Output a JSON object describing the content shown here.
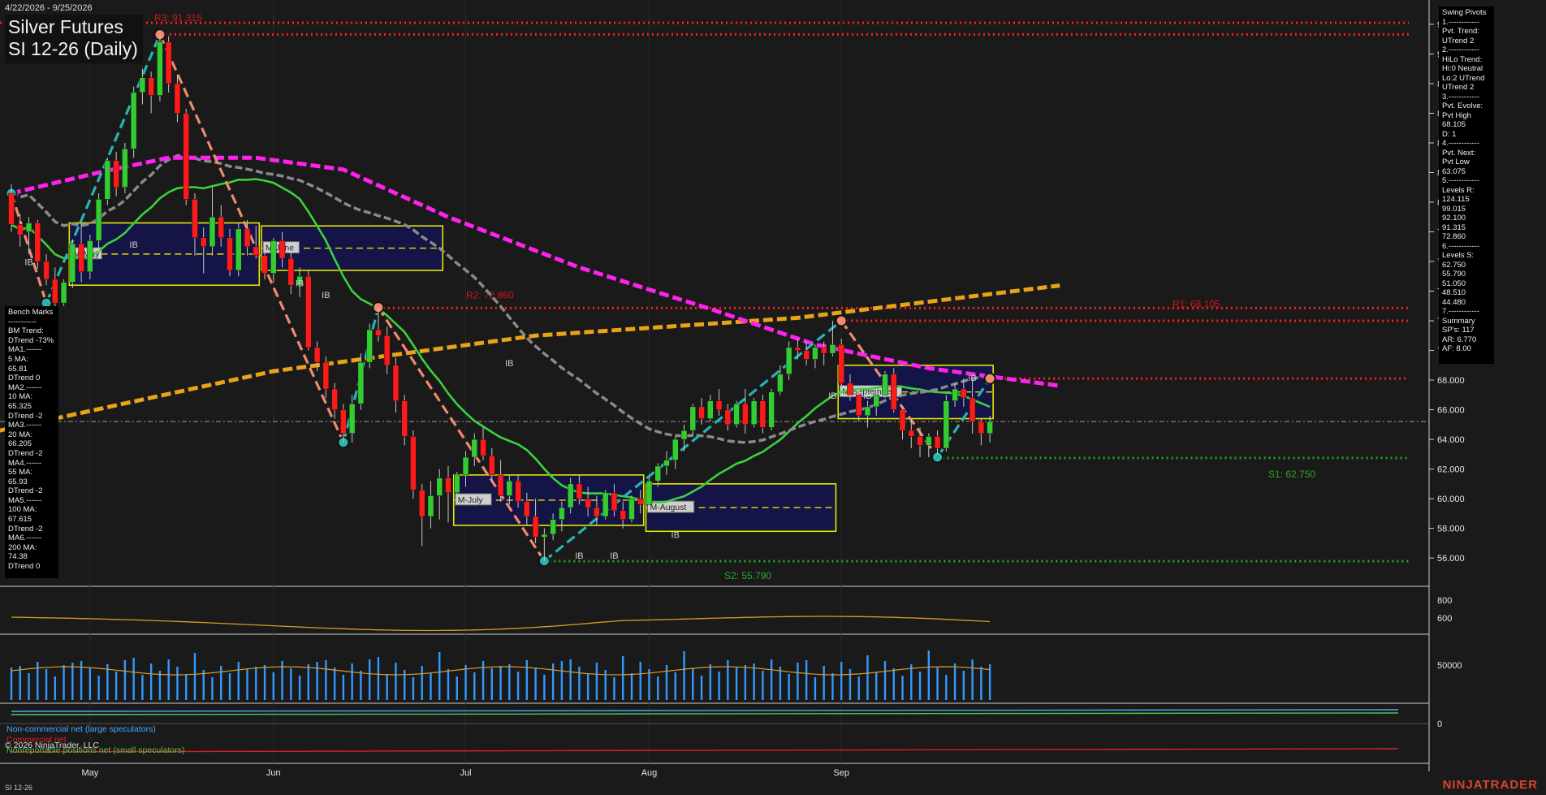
{
  "header": {
    "date_range": "4/22/2026 - 9/25/2026",
    "title_line1": "Silver Futures",
    "title_line2": "SI 12-26 (Daily)"
  },
  "price_axis": {
    "labels": [
      "92.000",
      "90.000",
      "88.000",
      "86.000",
      "84.000",
      "82.000",
      "80.000",
      "78.000",
      "76.000",
      "74.000",
      "72.000",
      "70.000",
      "68.000",
      "66.000",
      "64.000",
      "62.000",
      "60.000",
      "58.000",
      "56.000"
    ],
    "values": [
      92,
      90,
      88,
      86,
      84,
      82,
      80,
      78,
      76,
      74,
      72,
      70,
      68,
      66,
      64,
      62,
      60,
      58,
      56
    ],
    "range": [
      54.2,
      93.2
    ]
  },
  "oi_axis": {
    "labels": [
      "800",
      "600"
    ]
  },
  "volume_axis": {
    "labels": [
      "50000"
    ]
  },
  "cot_axis": {
    "labels": [
      "0"
    ]
  },
  "time_axis": {
    "labels": [
      "May",
      "Jun",
      "Jul",
      "Aug",
      "Sep"
    ],
    "bar_index": [
      9,
      30,
      52,
      73,
      95
    ]
  },
  "level_labels": {
    "r3": "R3: 91.315",
    "r2": "R2: 72.860",
    "r1": "R1: 68.105",
    "s1": "S1: 62.750",
    "s2": "S2: 55.790"
  },
  "month_labels": {
    "may": "M-May",
    "june": "M-June",
    "july": "M-July",
    "august": "M-August",
    "september": "M-September"
  },
  "ib_label": "IB",
  "benchmarks": [
    "Bench Marks",
    "-----------",
    "BM Trend:",
    "DTrend -73%",
    "MA1.------",
    "5 MA:",
    "65.81",
    "DTrend 0",
    "MA2.------",
    "10 MA:",
    "65.325",
    "DTrend -2",
    "MA3.------",
    "20 MA:",
    "66.205",
    "DTrend -2",
    "MA4.------",
    "55 MA:",
    "65.93",
    "DTrend -2",
    "MA5.------",
    "100 MA:",
    "67.615",
    "DTrend -2",
    "MA6.------",
    "200 MA:",
    "74.38",
    "DTrend 0"
  ],
  "swing_pivots": [
    "Swing Pivots",
    "1.------------",
    "Pvt. Trend:",
    "UTrend 2",
    "2.------------",
    "HiLo Trend:",
    "Hi:0 Neutral",
    "Lo:2 UTrend",
    "UTrend 2",
    "3.------------",
    "Pvt. Evolve:",
    "Pvt High",
    "68.105",
    "D: 1",
    "4.------------",
    "Pvt. Next:",
    "Pvt Low",
    "63.075",
    "5.------------",
    "Levels R:",
    "124.115",
    "99.015",
    "92.100",
    "91.315",
    "72.860",
    "6.------------",
    "Levels S:",
    "62.750",
    "55.790",
    "51.050",
    "48.510",
    "44.480",
    "7.------------",
    "Summary",
    "SP's: 117",
    "AR: 6.770",
    "AF: 8.00"
  ],
  "legend": {
    "noncommercial": "Non-commercial net (large speculators)",
    "commercial": "Commercial net",
    "nonreportable": "Nonreportable positions net (small speculators)"
  },
  "copyright": "© 2026 NinjaTrader, LLC",
  "footer_symbol": "SI 12-26",
  "brand": "NINJATRADER",
  "colors": {
    "background": "#1a1a1a",
    "up_candle": "#33cc33",
    "down_candle": "#ff1a1a",
    "ma_magenta": "#ff22ee",
    "ma_orange": "#e8a317",
    "ma_gray": "#8a8a8a",
    "ma_green": "#3bd13b",
    "swing_up": "#2ab3b3",
    "swing_down": "#f08a70",
    "resistance": "#ff2020",
    "support": "#22aa22",
    "month_box_fill": "#141446",
    "month_box_border": "#e5e500",
    "volume": "#3399ff"
  },
  "chart_data": {
    "type": "candlestick",
    "x_unit": "trading day index (0 = 4/22/2026)",
    "ohlc": [
      [
        80.6,
        81.2,
        78.0,
        78.5
      ],
      [
        78.5,
        79.2,
        77.0,
        77.8
      ],
      [
        78.0,
        79.0,
        76.5,
        78.6
      ],
      [
        78.6,
        78.8,
        75.5,
        76.0
      ],
      [
        76.0,
        76.5,
        74.4,
        74.8
      ],
      [
        74.8,
        75.6,
        72.6,
        73.2
      ],
      [
        73.2,
        74.8,
        73.0,
        74.6
      ],
      [
        74.6,
        77.5,
        74.2,
        77.2
      ],
      [
        77.2,
        78.6,
        74.6,
        75.3
      ],
      [
        75.3,
        77.8,
        74.8,
        77.4
      ],
      [
        77.4,
        80.6,
        76.6,
        80.2
      ],
      [
        80.2,
        83.0,
        79.8,
        82.8
      ],
      [
        82.8,
        83.4,
        80.4,
        81.0
      ],
      [
        81.0,
        84.0,
        80.6,
        83.6
      ],
      [
        83.6,
        87.8,
        83.0,
        87.4
      ],
      [
        87.4,
        89.0,
        86.6,
        88.4
      ],
      [
        88.4,
        88.8,
        86.0,
        87.2
      ],
      [
        87.2,
        91.3,
        86.8,
        90.8
      ],
      [
        90.8,
        91.2,
        87.4,
        88.0
      ],
      [
        88.0,
        88.6,
        85.4,
        86.0
      ],
      [
        86.0,
        86.3,
        79.8,
        80.2
      ],
      [
        80.2,
        80.6,
        76.4,
        77.6
      ],
      [
        77.6,
        78.3,
        75.2,
        77.0
      ],
      [
        77.0,
        81.0,
        76.4,
        79.0
      ],
      [
        79.0,
        79.8,
        77.0,
        77.6
      ],
      [
        77.6,
        78.2,
        75.0,
        75.4
      ],
      [
        75.4,
        78.6,
        75.0,
        78.2
      ],
      [
        78.2,
        78.8,
        76.4,
        77.0
      ],
      [
        77.0,
        78.4,
        76.2,
        76.4
      ],
      [
        76.4,
        76.9,
        74.8,
        75.2
      ],
      [
        75.2,
        77.6,
        74.6,
        77.4
      ],
      [
        77.4,
        78.0,
        75.6,
        76.2
      ],
      [
        76.2,
        76.6,
        73.8,
        74.4
      ],
      [
        74.4,
        75.6,
        73.6,
        75.0
      ],
      [
        75.0,
        75.4,
        70.0,
        70.2
      ],
      [
        70.2,
        70.6,
        68.6,
        69.2
      ],
      [
        69.2,
        69.6,
        66.8,
        67.4
      ],
      [
        67.4,
        67.8,
        65.4,
        66.0
      ],
      [
        66.0,
        66.4,
        63.8,
        64.4
      ],
      [
        64.4,
        67.0,
        63.8,
        66.4
      ],
      [
        66.4,
        69.8,
        66.0,
        69.2
      ],
      [
        69.2,
        71.8,
        68.8,
        71.4
      ],
      [
        71.4,
        72.9,
        70.6,
        71.0
      ],
      [
        71.0,
        71.6,
        68.4,
        69.0
      ],
      [
        69.0,
        69.5,
        65.8,
        66.6
      ],
      [
        66.6,
        67.0,
        63.6,
        64.2
      ],
      [
        64.2,
        64.6,
        60.0,
        60.6
      ],
      [
        60.6,
        61.0,
        56.8,
        58.8
      ],
      [
        58.8,
        61.2,
        58.0,
        60.2
      ],
      [
        60.2,
        62.0,
        58.6,
        61.4
      ],
      [
        61.4,
        62.2,
        58.4,
        60.4
      ],
      [
        60.4,
        61.8,
        59.6,
        61.6
      ],
      [
        61.6,
        63.2,
        60.8,
        62.8
      ],
      [
        62.8,
        64.4,
        62.2,
        64.0
      ],
      [
        64.0,
        64.8,
        62.6,
        62.9
      ],
      [
        62.9,
        63.4,
        61.2,
        61.6
      ],
      [
        61.6,
        62.6,
        59.8,
        60.2
      ],
      [
        60.2,
        61.6,
        59.6,
        61.2
      ],
      [
        61.2,
        61.6,
        59.4,
        59.8
      ],
      [
        59.8,
        60.4,
        58.2,
        58.8
      ],
      [
        58.8,
        60.0,
        57.0,
        57.4
      ],
      [
        57.4,
        58.0,
        55.8,
        57.6
      ],
      [
        57.6,
        59.0,
        57.2,
        58.6
      ],
      [
        58.6,
        59.8,
        57.8,
        59.4
      ],
      [
        59.4,
        61.4,
        59.0,
        61.0
      ],
      [
        61.0,
        61.6,
        59.6,
        60.0
      ],
      [
        60.0,
        60.8,
        58.8,
        59.4
      ],
      [
        59.4,
        60.2,
        58.2,
        58.8
      ],
      [
        58.8,
        60.6,
        58.6,
        60.4
      ],
      [
        60.4,
        61.0,
        58.8,
        59.2
      ],
      [
        59.2,
        59.8,
        58.0,
        58.6
      ],
      [
        58.6,
        60.2,
        58.4,
        60.0
      ],
      [
        60.0,
        60.6,
        59.0,
        59.6
      ],
      [
        59.6,
        61.4,
        59.2,
        61.2
      ],
      [
        61.2,
        62.4,
        60.8,
        62.2
      ],
      [
        62.2,
        63.2,
        61.6,
        62.6
      ],
      [
        62.6,
        64.2,
        62.0,
        64.0
      ],
      [
        64.0,
        65.0,
        63.2,
        64.6
      ],
      [
        64.6,
        66.4,
        64.2,
        66.2
      ],
      [
        66.2,
        66.8,
        65.0,
        65.4
      ],
      [
        65.4,
        67.0,
        65.2,
        66.6
      ],
      [
        66.6,
        67.4,
        65.6,
        66.0
      ],
      [
        66.0,
        66.4,
        64.6,
        65.0
      ],
      [
        65.0,
        66.6,
        64.8,
        66.4
      ],
      [
        66.4,
        67.4,
        64.4,
        65.0
      ],
      [
        65.0,
        66.8,
        64.8,
        66.6
      ],
      [
        66.6,
        67.0,
        64.4,
        64.8
      ],
      [
        64.8,
        67.4,
        64.6,
        67.2
      ],
      [
        67.2,
        69.0,
        67.0,
        68.4
      ],
      [
        68.4,
        70.6,
        68.0,
        70.2
      ],
      [
        70.2,
        70.8,
        69.4,
        70.0
      ],
      [
        70.0,
        70.6,
        69.0,
        69.4
      ],
      [
        69.4,
        70.4,
        68.8,
        70.2
      ],
      [
        70.2,
        70.6,
        69.0,
        69.8
      ],
      [
        69.8,
        72.0,
        69.6,
        70.4
      ],
      [
        70.4,
        70.8,
        67.6,
        67.8
      ],
      [
        67.8,
        68.4,
        66.6,
        67.0
      ],
      [
        67.0,
        67.6,
        65.2,
        65.6
      ],
      [
        65.6,
        66.6,
        64.8,
        66.2
      ],
      [
        66.2,
        67.4,
        65.6,
        67.0
      ],
      [
        67.0,
        68.6,
        66.8,
        68.4
      ],
      [
        68.4,
        68.8,
        65.8,
        66.0
      ],
      [
        66.0,
        66.2,
        64.0,
        64.6
      ],
      [
        64.6,
        65.4,
        63.4,
        64.2
      ],
      [
        64.2,
        64.8,
        62.8,
        63.6
      ],
      [
        63.6,
        64.4,
        62.8,
        64.2
      ],
      [
        64.2,
        64.6,
        63.0,
        63.4
      ],
      [
        63.4,
        67.0,
        63.2,
        66.6
      ],
      [
        66.6,
        67.8,
        66.2,
        67.4
      ],
      [
        67.4,
        68.1,
        66.2,
        66.8
      ],
      [
        66.8,
        68.0,
        64.4,
        65.2
      ],
      [
        65.2,
        65.4,
        63.6,
        64.4
      ],
      [
        64.4,
        65.6,
        63.8,
        65.2
      ]
    ],
    "moving_averages": [
      {
        "name": "5 MA",
        "value": 65.81
      },
      {
        "name": "10 MA",
        "value": 65.325
      },
      {
        "name": "20 MA",
        "value": 66.205
      },
      {
        "name": "55 MA",
        "value": 65.93
      },
      {
        "name": "100 MA",
        "value": 67.615
      },
      {
        "name": "200 MA",
        "value": 74.38
      }
    ],
    "resistance_levels": [
      92.1,
      91.315,
      72.86,
      68.105
    ],
    "support_levels": [
      62.75,
      55.79
    ],
    "swing_pivots": [
      [
        0,
        80.6
      ],
      [
        4,
        73.2
      ],
      [
        17,
        91.3
      ],
      [
        38,
        63.8
      ],
      [
        42,
        72.9
      ],
      [
        61,
        55.8
      ],
      [
        95,
        72.0
      ],
      [
        106,
        62.8
      ],
      [
        112,
        68.1
      ]
    ],
    "month_boxes": [
      {
        "label": "M-May",
        "from": 7,
        "to": 28,
        "high": 78.6,
        "low": 74.4
      },
      {
        "label": "M-June",
        "from": 29,
        "to": 49,
        "high": 78.4,
        "low": 75.4
      },
      {
        "label": "M-July",
        "from": 51,
        "to": 72,
        "high": 61.6,
        "low": 58.2
      },
      {
        "label": "M-August",
        "from": 73,
        "to": 94,
        "high": 61.0,
        "low": 57.8
      },
      {
        "label": "M-September",
        "from": 95,
        "to": 112,
        "high": 69.0,
        "low": 65.4
      }
    ]
  }
}
